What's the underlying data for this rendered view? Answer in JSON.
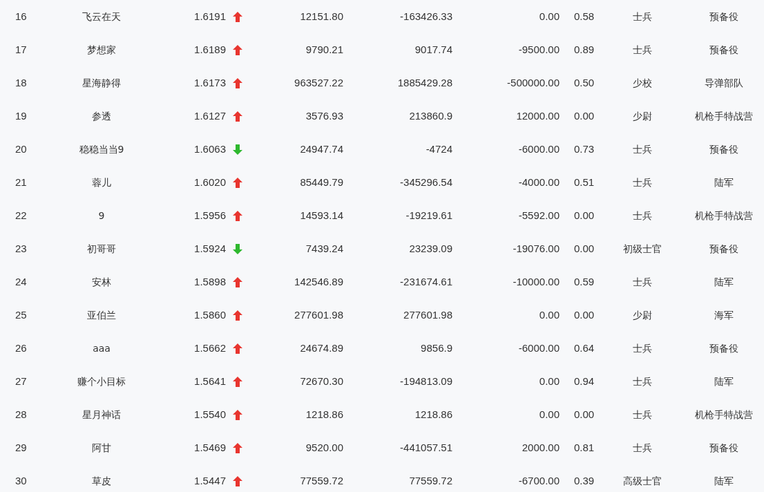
{
  "rows": [
    {
      "rank": "16",
      "name": "飞云在天",
      "ratio": "1.6191",
      "rising": true,
      "column_4": "12151.80",
      "column_5": "-163426.33",
      "column_6": "0.00",
      "column_7": "0.58",
      "rank_title": "士兵",
      "unit": "预备役"
    },
    {
      "rank": "17",
      "name": "梦想家",
      "ratio": "1.6189",
      "rising": true,
      "column_4": "9790.21",
      "column_5": "9017.74",
      "column_6": "-9500.00",
      "column_7": "0.89",
      "rank_title": "士兵",
      "unit": "预备役"
    },
    {
      "rank": "18",
      "name": "星海静得",
      "ratio": "1.6173",
      "rising": true,
      "column_4": "963527.22",
      "column_5": "1885429.28",
      "column_6": "-500000.00",
      "column_7": "0.50",
      "rank_title": "少校",
      "unit": "导弹部队"
    },
    {
      "rank": "19",
      "name": "参透",
      "ratio": "1.6127",
      "rising": true,
      "column_4": "3576.93",
      "column_5": "213860.9",
      "column_6": "12000.00",
      "column_7": "0.00",
      "rank_title": "少尉",
      "unit": "机枪手特战营"
    },
    {
      "rank": "20",
      "name": "稳稳当当9",
      "ratio": "1.6063",
      "rising": false,
      "column_4": "24947.74",
      "column_5": "-4724",
      "column_6": "-6000.00",
      "column_7": "0.73",
      "rank_title": "士兵",
      "unit": "预备役"
    },
    {
      "rank": "21",
      "name": "蓉儿",
      "ratio": "1.6020",
      "rising": true,
      "column_4": "85449.79",
      "column_5": "-345296.54",
      "column_6": "-4000.00",
      "column_7": "0.51",
      "rank_title": "士兵",
      "unit": "陆军"
    },
    {
      "rank": "22",
      "name": "9",
      "ratio": "1.5956",
      "rising": true,
      "column_4": "14593.14",
      "column_5": "-19219.61",
      "column_6": "-5592.00",
      "column_7": "0.00",
      "rank_title": "士兵",
      "unit": "机枪手特战营"
    },
    {
      "rank": "23",
      "name": "初哥哥",
      "ratio": "1.5924",
      "rising": false,
      "column_4": "7439.24",
      "column_5": "23239.09",
      "column_6": "-19076.00",
      "column_7": "0.00",
      "rank_title": "初级士官",
      "unit": "预备役"
    },
    {
      "rank": "24",
      "name": "安林",
      "ratio": "1.5898",
      "rising": true,
      "column_4": "142546.89",
      "column_5": "-231674.61",
      "column_6": "-10000.00",
      "column_7": "0.59",
      "rank_title": "士兵",
      "unit": "陆军"
    },
    {
      "rank": "25",
      "name": "亚伯兰",
      "ratio": "1.5860",
      "rising": true,
      "column_4": "277601.98",
      "column_5": "277601.98",
      "column_6": "0.00",
      "column_7": "0.00",
      "rank_title": "少尉",
      "unit": "海军"
    },
    {
      "rank": "26",
      "name": "aaa",
      "ratio": "1.5662",
      "rising": true,
      "column_4": "24674.89",
      "column_5": "9856.9",
      "column_6": "-6000.00",
      "column_7": "0.64",
      "rank_title": "士兵",
      "unit": "预备役"
    },
    {
      "rank": "27",
      "name": "赚个小目标",
      "ratio": "1.5641",
      "rising": true,
      "column_4": "72670.30",
      "column_5": "-194813.09",
      "column_6": "0.00",
      "column_7": "0.94",
      "rank_title": "士兵",
      "unit": "陆军"
    },
    {
      "rank": "28",
      "name": "星月神话",
      "ratio": "1.5540",
      "rising": true,
      "column_4": "1218.86",
      "column_5": "1218.86",
      "column_6": "0.00",
      "column_7": "0.00",
      "rank_title": "士兵",
      "unit": "机枪手特战营"
    },
    {
      "rank": "29",
      "name": "阿甘",
      "ratio": "1.5469",
      "rising": true,
      "column_4": "9520.00",
      "column_5": "-441057.51",
      "column_6": "2000.00",
      "column_7": "0.81",
      "rank_title": "士兵",
      "unit": "预备役"
    },
    {
      "rank": "30",
      "name": "草皮",
      "ratio": "1.5447",
      "rising": true,
      "column_4": "77559.72",
      "column_5": "77559.72",
      "column_6": "-6700.00",
      "column_7": "0.39",
      "rank_title": "高级士官",
      "unit": "陆军"
    }
  ]
}
